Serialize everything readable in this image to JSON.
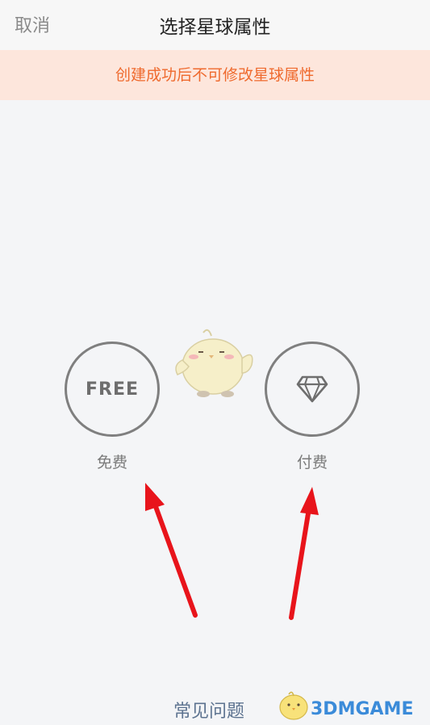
{
  "header": {
    "cancel_label": "取消",
    "title": "选择星球属性"
  },
  "notice": {
    "text": "创建成功后不可修改星球属性"
  },
  "options": {
    "free": {
      "badge": "FREE",
      "label": "免费"
    },
    "paid": {
      "icon": "diamond-icon",
      "label": "付费"
    }
  },
  "footer": {
    "faq_label": "常见问题",
    "watermark": "3DMGAME"
  },
  "colors": {
    "notice_bg": "#fde6dc",
    "notice_text": "#ef6a2e",
    "arrow": "#e8141b",
    "circle_border": "#7f7f7f"
  }
}
